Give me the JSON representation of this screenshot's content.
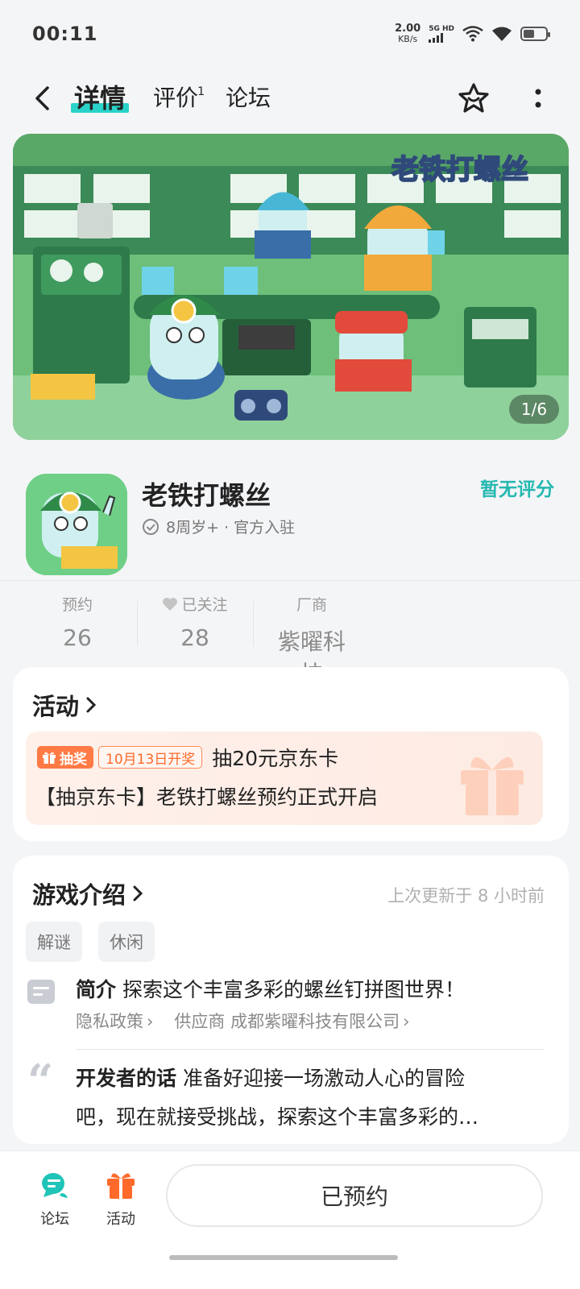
{
  "status_bar": {
    "time": "00:11",
    "net_speed_value": "2.00",
    "net_speed_unit": "KB/s",
    "signal_label": "5G HD",
    "battery_level": 0.5
  },
  "nav": {
    "tabs": [
      {
        "label": "详情",
        "active": true
      },
      {
        "label": "评价",
        "badge": "1"
      },
      {
        "label": "论坛"
      }
    ]
  },
  "banner": {
    "logo_text": "老铁打螺丝",
    "counter": "1/6"
  },
  "app": {
    "name": "老铁打螺丝",
    "meta": "8周岁+ · 官方入驻",
    "score": "暂无评分"
  },
  "stats": [
    {
      "key": "预约",
      "value": "26"
    },
    {
      "key": "已关注",
      "value": "28"
    },
    {
      "key": "厂商",
      "value": "紫曜科技"
    }
  ],
  "activity": {
    "title": "活动",
    "badge": "抽奖",
    "date_badge": "10月13日开奖",
    "prize": "抽20元京东卡",
    "desc": "【抽京东卡】老铁打螺丝预约正式开启"
  },
  "intro": {
    "title": "游戏介绍",
    "updated": "上次更新于 8 小时前",
    "tags": [
      "解谜",
      "休闲"
    ],
    "summary_label": "简介",
    "summary": "探索这个丰富多彩的螺丝钉拼图世界！",
    "privacy": "隐私政策",
    "supplier_label": "供应商",
    "supplier": "成都紫曜科技有限公司",
    "dev_label": "开发者的话",
    "dev_line1": "准备好迎接一场激动人心的冒险",
    "dev_line2": "吧，现在就接受挑战，探索这个丰富多彩的…"
  },
  "bottom": {
    "forum": "论坛",
    "activity": "活动",
    "reserve": "已预约"
  },
  "colors": {
    "accent": "#2ad3c9",
    "score": "#24b8b0",
    "promo": "#ff7a45"
  }
}
